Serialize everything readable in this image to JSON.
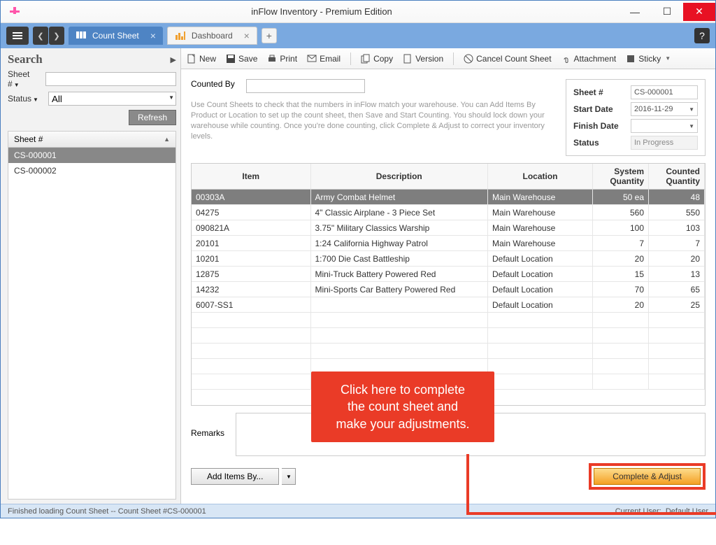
{
  "window": {
    "title": "inFlow Inventory - Premium Edition"
  },
  "tabs": {
    "active": "Count Sheet",
    "inactive": "Dashboard"
  },
  "sidebar": {
    "search_heading": "Search",
    "sheet_label": "Sheet #",
    "status_label": "Status",
    "status_value": "All",
    "refresh": "Refresh",
    "col_header": "Sheet #",
    "rows": [
      "CS-000001",
      "CS-000002"
    ],
    "selected": 0
  },
  "toolbar": {
    "new": "New",
    "save": "Save",
    "print": "Print",
    "email": "Email",
    "copy": "Copy",
    "version": "Version",
    "cancel": "Cancel Count Sheet",
    "attachment": "Attachment",
    "sticky": "Sticky"
  },
  "counted_by_label": "Counted By",
  "info_text": "Use Count Sheets to check that the numbers in inFlow match your warehouse.  You can Add Items By Product or Location to set up the count sheet, then Save and Start Counting.  You should lock down your warehouse while counting.  Once you're done counting, click Complete & Adjust to correct your inventory levels.",
  "meta": {
    "sheet_label": "Sheet #",
    "sheet_value": "CS-000001",
    "start_label": "Start Date",
    "start_value": "2016-11-29",
    "finish_label": "Finish Date",
    "finish_value": "",
    "status_label": "Status",
    "status_value": "In Progress"
  },
  "grid": {
    "cols": {
      "item": "Item",
      "desc": "Description",
      "loc": "Location",
      "sys": "System Quantity",
      "count": "Counted Quantity"
    },
    "rows": [
      {
        "item": "00303A",
        "desc": "Army Combat Helmet",
        "loc": "Main Warehouse",
        "sys": "50 ea",
        "count": "48"
      },
      {
        "item": "04275",
        "desc": "4\" Classic Airplane - 3 Piece Set",
        "loc": "Main Warehouse",
        "sys": "560",
        "count": "550"
      },
      {
        "item": "090821A",
        "desc": "3.75\" Military Classics Warship",
        "loc": "Main Warehouse",
        "sys": "100",
        "count": "103"
      },
      {
        "item": "20101",
        "desc": "1:24 California Highway Patrol",
        "loc": "Main Warehouse",
        "sys": "7",
        "count": "7"
      },
      {
        "item": "10201",
        "desc": "1:700 Die Cast Battleship",
        "loc": "Default Location",
        "sys": "20",
        "count": "20"
      },
      {
        "item": "12875",
        "desc": "Mini-Truck Battery Powered Red",
        "loc": "Default Location",
        "sys": "15",
        "count": "13"
      },
      {
        "item": "14232",
        "desc": "Mini-Sports Car Battery Powered Red",
        "loc": "Default Location",
        "sys": "70",
        "count": "65"
      },
      {
        "item": "6007-SS1",
        "desc": "",
        "loc": "Default Location",
        "sys": "20",
        "count": "25"
      }
    ],
    "selected": 0
  },
  "remarks_label": "Remarks",
  "add_items": "Add Items By...",
  "complete": "Complete & Adjust",
  "callout": {
    "line1": "Click here to complete",
    "line2": "the count sheet and",
    "line3": "make your adjustments."
  },
  "statusbar": {
    "left": "Finished loading Count Sheet -- Count Sheet #CS-000001",
    "right_label": "Current User:",
    "right_value": "Default User"
  }
}
